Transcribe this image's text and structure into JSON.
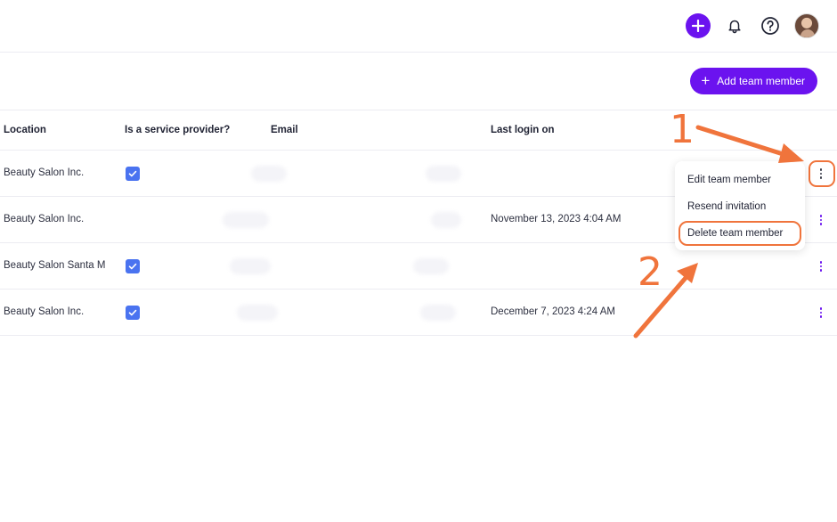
{
  "header": {
    "icons": [
      "plus-icon",
      "bell-icon",
      "help-icon",
      "avatar"
    ]
  },
  "toolbar": {
    "add_label": "Add team member"
  },
  "table": {
    "columns": {
      "location": "Location",
      "provider": "Is a service provider?",
      "email": "Email",
      "last_login": "Last login on"
    },
    "rows": [
      {
        "location": "Beauty Salon Inc.",
        "provider": true,
        "last_login": ""
      },
      {
        "location": "Beauty Salon Inc.",
        "provider": false,
        "last_login": "November 13, 2023 4:04 AM"
      },
      {
        "location": "Beauty Salon Santa M",
        "provider": true,
        "last_login": ""
      },
      {
        "location": "Beauty Salon Inc.",
        "provider": true,
        "last_login": "December 7, 2023 4:24 AM"
      }
    ]
  },
  "menu": {
    "items": [
      "Edit team member",
      "Resend invitation",
      "Delete team member"
    ]
  },
  "annotations": {
    "step1": "1",
    "step2": "2"
  },
  "colors": {
    "accent": "#6b13ef",
    "checkbox": "#4a73f0",
    "annotation": "#f0743c"
  }
}
